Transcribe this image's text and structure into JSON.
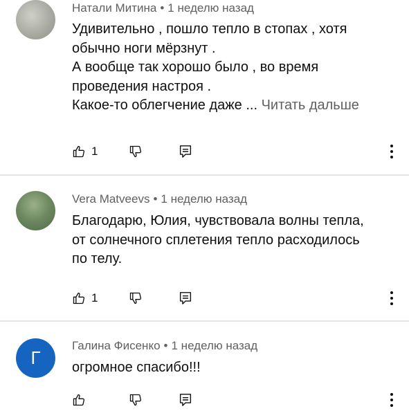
{
  "comments": [
    {
      "author": "Натали Митина",
      "time": "1 неделю назад",
      "lines": [
        "Удивительно , пошло тепло в стопах , хотя",
        "обычно ноги мёрзнут .",
        "А вообще так хорошо было , во время",
        "проведения настроя .",
        "Какое-то облегчение даже ..."
      ],
      "read_more": "Читать дальше",
      "likes": "1"
    },
    {
      "author": "Vera Matveevs",
      "time": "1 неделю назад",
      "lines": [
        "Благодарю, Юлия, чувствовала волны тепла,",
        "от солнечного сплетения тепло расходилось",
        "по телу."
      ],
      "likes": "1"
    },
    {
      "author": "Галина Фисенко",
      "avatar_letter": "Г",
      "time": "1 неделю назад",
      "lines": [
        "огромное спасибо!!!"
      ]
    }
  ],
  "meta_separator": "•",
  "icons": {
    "like": "thumb-up-icon",
    "dislike": "thumb-down-icon",
    "reply": "reply-icon",
    "more": "more-vertical-icon"
  },
  "colors": {
    "avatar_letter_bg": "#1565c0",
    "secondary_text": "#606060"
  }
}
